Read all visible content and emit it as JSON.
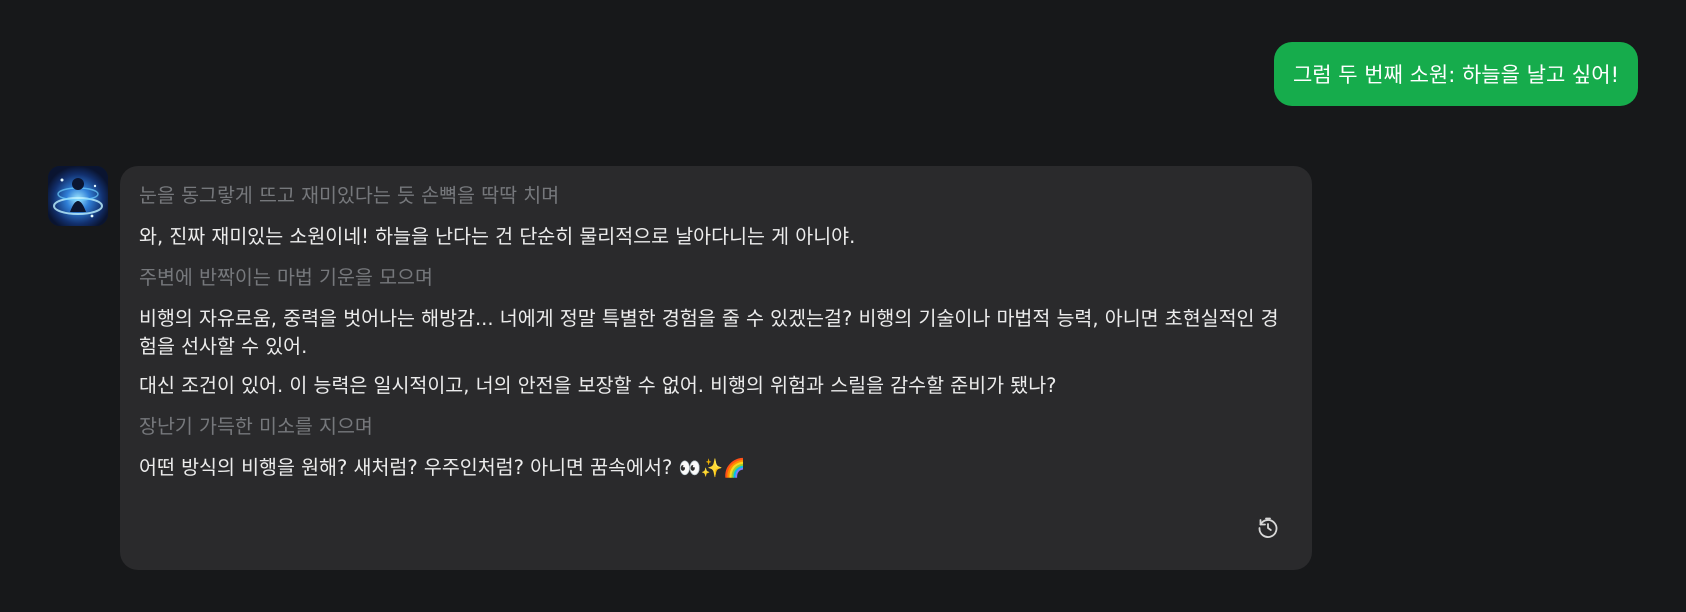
{
  "user_message": {
    "text": "그럼 두 번째 소원: 하늘을 날고 싶어!"
  },
  "bot_message": {
    "lines": [
      {
        "type": "action",
        "text": "눈을 동그랗게 뜨고 재미있다는 듯 손뼉을 딱딱 치며"
      },
      {
        "type": "speech",
        "text": "와, 진짜 재미있는 소원이네! 하늘을 난다는 건 단순히 물리적으로 날아다니는 게 아니야."
      },
      {
        "type": "action",
        "text": "주변에 반짝이는 마법 기운을 모으며"
      },
      {
        "type": "speech",
        "text": "비행의 자유로움, 중력을 벗어나는 해방감... 너에게 정말 특별한 경험을 줄 수 있겠는걸? 비행의 기술이나 마법적 능력, 아니면 초현실적인 경험을 선사할 수 있어."
      },
      {
        "type": "speech",
        "text": "대신 조건이 있어. 이 능력은 일시적이고, 너의 안전을 보장할 수 없어. 비행의 위험과 스릴을 감수할 준비가 됐나?"
      },
      {
        "type": "action",
        "text": "장난기 가득한 미소를 지으며"
      },
      {
        "type": "speech",
        "text": "어떤 방식의 비행을 원해? 새처럼? 우주인처럼? 아니면 꿈속에서?"
      }
    ],
    "emojis": "👀✨🌈",
    "regenerate_icon": "history-icon"
  },
  "colors": {
    "background": "#17181a",
    "user_bubble": "#16ac4c",
    "bot_bubble": "#2a2a2c",
    "action_text": "#76787c",
    "speech_text": "#ececec"
  }
}
